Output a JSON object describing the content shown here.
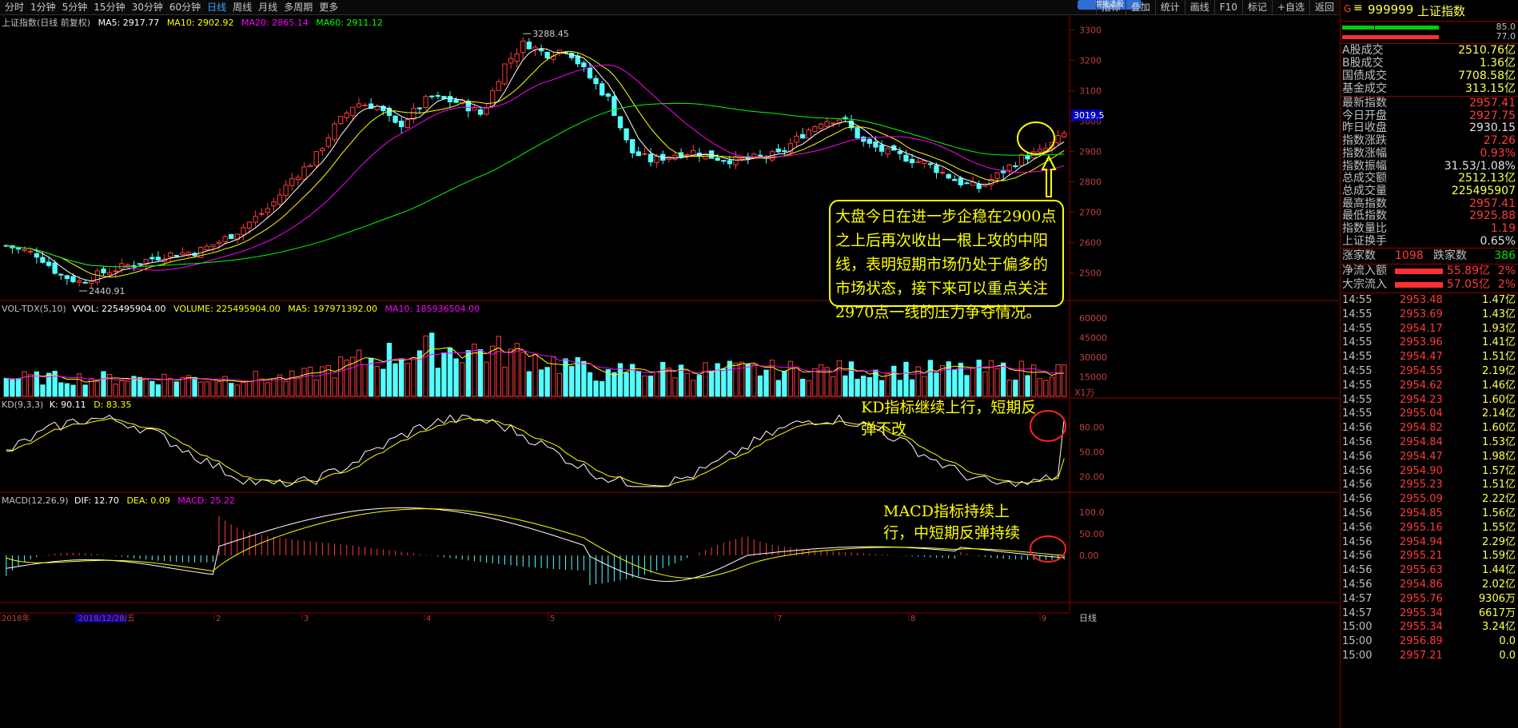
{
  "top_tabs": [
    "分时",
    "1分钟",
    "5分钟",
    "15分钟",
    "30分钟",
    "60分钟",
    "日线",
    "周线",
    "月线",
    "多周期",
    "更多"
  ],
  "active_tab": "日线",
  "toolbar": [
    "指标",
    "叠加",
    "统计",
    "画线",
    "F10",
    "标记",
    "+自选",
    "返回"
  ],
  "quick_button": "智能选股",
  "main_legend": {
    "name": "上证指数(日线 前复权)",
    "ma5": "MA5: 2917.77",
    "ma10": "MA10: 2902.92",
    "ma20": "MA20: 2865.14",
    "ma60": "MA60: 2911.12"
  },
  "vol_legend": {
    "name": "VOL-TDX(5,10)",
    "vvol": "VVOL: 225495904.00",
    "volume": "VOLUME: 225495904.00",
    "ma5": "MA5: 197971392.00",
    "ma10": "MA10: 185936504.00"
  },
  "kd_legend": {
    "name": "KD(9,3,3)",
    "k": "K: 90.11",
    "d": "D: 83.35"
  },
  "macd_legend": {
    "name": "MACD(12,26,9)",
    "dif": "DIF: 12.70",
    "dea": "DEA: 0.09",
    "macd": "MACD: 25.22"
  },
  "price_axis": [
    "3300",
    "3200",
    "3100",
    "3000",
    "2900",
    "2800",
    "2700",
    "2600",
    "2500"
  ],
  "current_price_tag": "3019.5",
  "vol_axis": [
    "60000",
    "45000",
    "30000",
    "15000"
  ],
  "vol_unit": "X1万",
  "kd_axis": [
    "80.00",
    "50.00",
    "20.00"
  ],
  "macd_axis": [
    "100.0",
    "50.00",
    "0.00"
  ],
  "high_label": "3288.45",
  "low_label": "2440.91",
  "date_axis": [
    "2018年",
    "2018/12/28/五",
    "2",
    "3",
    "4",
    "5",
    "7",
    "8",
    "9"
  ],
  "date_axis_right": "日线",
  "annotations": {
    "main": "大盘今日在进一步企稳在2900点之上后再次收出一根上攻的中阳线，表明短期市场仍处于偏多的市场状态，接下来可以重点关注2970点一线的压力争夺情况。",
    "kd": "KD指标继续上行，短期反弹不改",
    "macd": "MACD指标持续上行，中短期反弹持续"
  },
  "panel": {
    "code": "999999",
    "name": "上证指数",
    "bar1": "85.0",
    "bar2": "77.0",
    "summary": [
      {
        "k": "A股成交",
        "v": "2510.76亿"
      },
      {
        "k": "B股成交",
        "v": "1.36亿"
      },
      {
        "k": "国债成交",
        "v": "7708.58亿"
      },
      {
        "k": "基金成交",
        "v": "313.15亿"
      }
    ],
    "stats": [
      {
        "k": "最新指数",
        "v": "2957.41",
        "c": "#ff3b3b"
      },
      {
        "k": "今日开盘",
        "v": "2927.75",
        "c": "#ff3b3b"
      },
      {
        "k": "昨日收盘",
        "v": "2930.15",
        "c": "#e0e0e0"
      },
      {
        "k": "指数涨跌",
        "v": "27.26",
        "c": "#ff3b3b"
      },
      {
        "k": "指数涨幅",
        "v": "0.93%",
        "c": "#ff3b3b"
      },
      {
        "k": "指数振幅",
        "v": "31.53/1.08%",
        "c": "#e0e0e0"
      },
      {
        "k": "总成交额",
        "v": "2512.13亿",
        "c": "#ffff55"
      },
      {
        "k": "总成交量",
        "v": "225495907",
        "c": "#ffff55"
      },
      {
        "k": "最高指数",
        "v": "2957.41",
        "c": "#ff3b3b"
      },
      {
        "k": "最低指数",
        "v": "2925.88",
        "c": "#ff3b3b"
      },
      {
        "k": "指数量比",
        "v": "1.19",
        "c": "#ff3b3b"
      },
      {
        "k": "上证换手",
        "v": "0.65%",
        "c": "#e0e0e0"
      }
    ],
    "updown": {
      "up_label": "涨家数",
      "up": "1098",
      "down_label": "跌家数",
      "down": "386"
    },
    "flows": [
      {
        "k": "净流入额",
        "v": "55.89亿",
        "p": "2%"
      },
      {
        "k": "大宗流入",
        "v": "57.05亿",
        "p": "2%"
      }
    ],
    "ticks": [
      [
        "14:55",
        "2953.48",
        "1.47亿"
      ],
      [
        "14:55",
        "2953.69",
        "1.43亿"
      ],
      [
        "14:55",
        "2954.17",
        "1.93亿"
      ],
      [
        "14:55",
        "2953.96",
        "1.41亿"
      ],
      [
        "14:55",
        "2954.47",
        "1.51亿"
      ],
      [
        "14:55",
        "2954.55",
        "2.19亿"
      ],
      [
        "14:55",
        "2954.62",
        "1.46亿"
      ],
      [
        "14:55",
        "2954.23",
        "1.60亿"
      ],
      [
        "14:55",
        "2955.04",
        "2.14亿"
      ],
      [
        "14:56",
        "2954.82",
        "1.60亿"
      ],
      [
        "14:56",
        "2954.84",
        "1.53亿"
      ],
      [
        "14:56",
        "2954.47",
        "1.98亿"
      ],
      [
        "14:56",
        "2954.90",
        "1.57亿"
      ],
      [
        "14:56",
        "2955.23",
        "1.51亿"
      ],
      [
        "14:56",
        "2955.09",
        "2.22亿"
      ],
      [
        "14:56",
        "2954.85",
        "1.56亿"
      ],
      [
        "14:56",
        "2955.16",
        "1.55亿"
      ],
      [
        "14:56",
        "2954.94",
        "2.29亿"
      ],
      [
        "14:56",
        "2955.21",
        "1.59亿"
      ],
      [
        "14:56",
        "2955.63",
        "1.44亿"
      ],
      [
        "14:56",
        "2954.86",
        "2.02亿"
      ],
      [
        "14:57",
        "2955.76",
        "9306万"
      ],
      [
        "14:57",
        "2955.34",
        "6617万"
      ],
      [
        "15:00",
        "2955.34",
        "3.24亿"
      ],
      [
        "15:00",
        "2956.89",
        "0.0"
      ],
      [
        "15:00",
        "2957.21",
        "0.0"
      ]
    ]
  },
  "colors": {
    "up": "#ff3b3b",
    "down": "#54ffff",
    "ma5": "#ffffff",
    "ma10": "#ffff00",
    "ma20": "#ff00ff",
    "ma60": "#00ff00",
    "border": "#8b0000"
  }
}
